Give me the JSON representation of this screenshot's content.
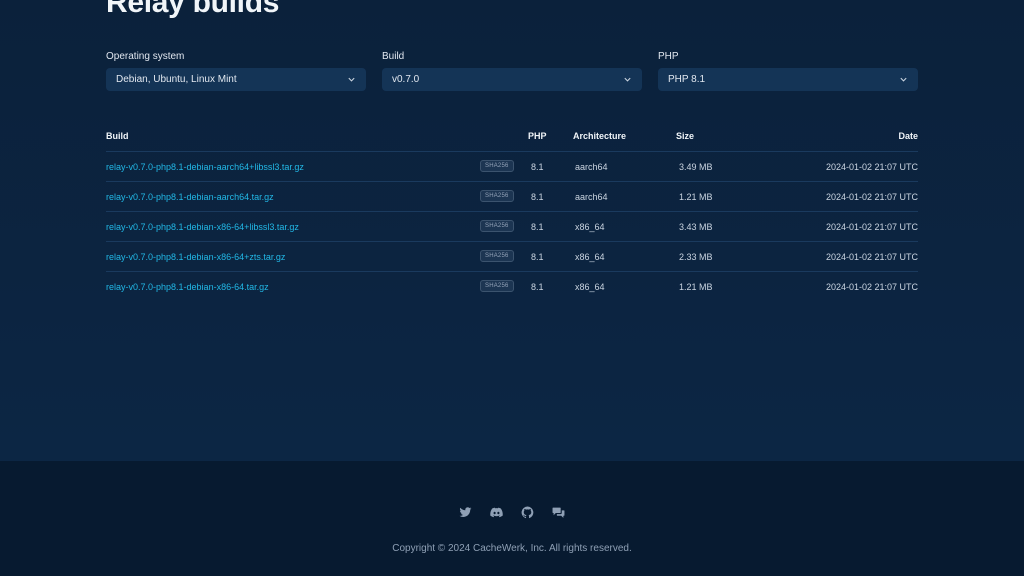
{
  "page": {
    "title": "Relay builds"
  },
  "filters": {
    "os": {
      "label": "Operating system",
      "value": "Debian, Ubuntu, Linux Mint"
    },
    "build": {
      "label": "Build",
      "value": "v0.7.0"
    },
    "php": {
      "label": "PHP",
      "value": "PHP 8.1"
    }
  },
  "table": {
    "headers": {
      "build": "Build",
      "php": "PHP",
      "arch": "Architecture",
      "size": "Size",
      "date": "Date"
    },
    "rows": [
      {
        "file": "relay-v0.7.0-php8.1-debian-aarch64+libssl3.tar.gz",
        "sha": "SHA256",
        "php": "8.1",
        "arch": "aarch64",
        "size": "3.49 MB",
        "date": "2024-01-02 21:07 UTC"
      },
      {
        "file": "relay-v0.7.0-php8.1-debian-aarch64.tar.gz",
        "sha": "SHA256",
        "php": "8.1",
        "arch": "aarch64",
        "size": "1.21 MB",
        "date": "2024-01-02 21:07 UTC"
      },
      {
        "file": "relay-v0.7.0-php8.1-debian-x86-64+libssl3.tar.gz",
        "sha": "SHA256",
        "php": "8.1",
        "arch": "x86_64",
        "size": "3.43 MB",
        "date": "2024-01-02 21:07 UTC"
      },
      {
        "file": "relay-v0.7.0-php8.1-debian-x86-64+zts.tar.gz",
        "sha": "SHA256",
        "php": "8.1",
        "arch": "x86_64",
        "size": "2.33 MB",
        "date": "2024-01-02 21:07 UTC"
      },
      {
        "file": "relay-v0.7.0-php8.1-debian-x86-64.tar.gz",
        "sha": "SHA256",
        "php": "8.1",
        "arch": "x86_64",
        "size": "1.21 MB",
        "date": "2024-01-02 21:07 UTC"
      }
    ]
  },
  "footer": {
    "social_icons": [
      "twitter-icon",
      "discord-icon",
      "github-icon",
      "chat-icon"
    ],
    "copyright": "Copyright © 2024 CacheWerk, Inc. All rights reserved."
  },
  "colors": {
    "background": "#0c2542",
    "footer": "#071a30",
    "link": "#22b8e6",
    "select": "#143456"
  }
}
